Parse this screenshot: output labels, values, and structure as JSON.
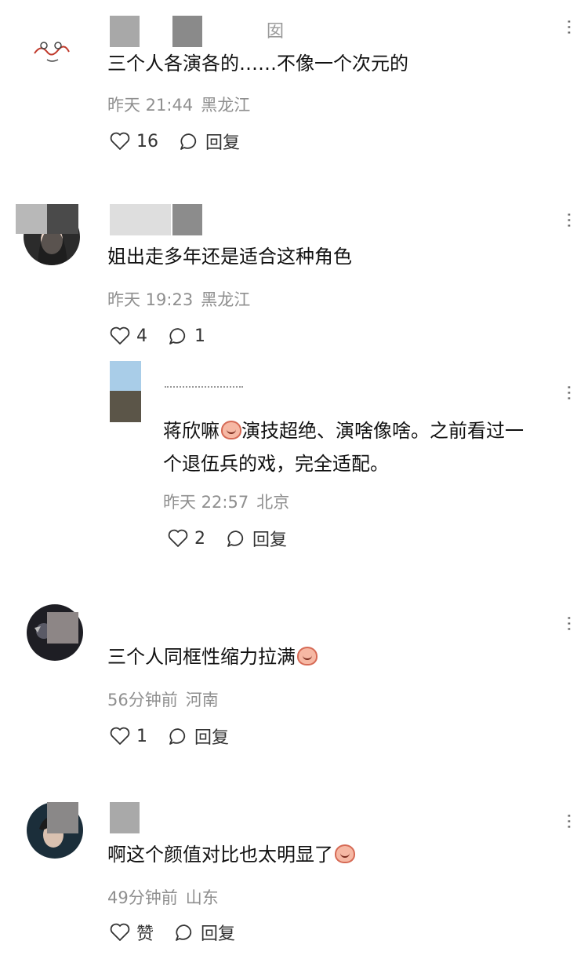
{
  "comments": [
    {
      "name": "囡",
      "content": "三个人各演各的……不像一个次元的",
      "time": "昨天 21:44",
      "location": "黑龙江",
      "likes": "16",
      "reply_label": "回复"
    },
    {
      "content": "姐出走多年还是适合这种角色",
      "time": "昨天 19:23",
      "location": "黑龙江",
      "likes": "4",
      "replies": "1"
    },
    {
      "content_line1": "蒋欣嘛",
      "content_line1b": "演技超绝、演啥像啥。之前看过一",
      "content_line2": "个退伍兵的戏，完全适配。",
      "time": "昨天 22:57",
      "location": "北京",
      "likes": "2",
      "reply_label": "回复"
    },
    {
      "content": "三个人同框性缩力拉满",
      "time": "56分钟前",
      "location": "河南",
      "likes": "1",
      "reply_label": "回复"
    },
    {
      "content": "啊这个颜值对比也太明显了",
      "time": "49分钟前",
      "location": "山东",
      "likes": "赞",
      "reply_label": "回复"
    }
  ],
  "icons": {
    "like": "heart-outline-icon",
    "reply": "comment-bubble-icon",
    "more": "more-vertical-icon"
  }
}
